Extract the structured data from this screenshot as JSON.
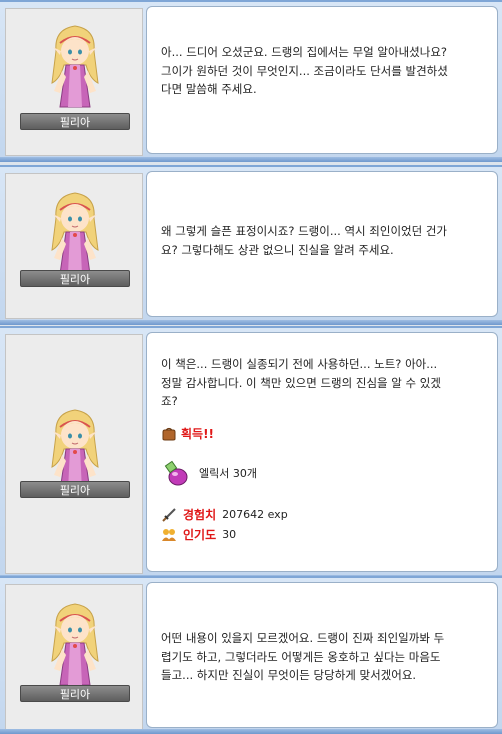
{
  "dialogs": [
    {
      "npc_name": "필리아",
      "lines": "아... 드디어 오셨군요. 드랭의 집에서는 무얼 알아내셨나요?\n그이가 원하던 것이 무엇인지... 조금이라도 단서를 발견하셨\n다면 말씀해 주세요."
    },
    {
      "npc_name": "필리아",
      "lines": "왜 그렇게 슬픈 표정이시죠? 드랭이... 역시 죄인이었던 건가\n요? 그렇다해도 상관 없으니 진실을 알려 주세요."
    },
    {
      "npc_name": "필리아",
      "lines": "이 책은... 드랭이 실종되기 전에 사용하던... 노트? 아아...\n정말 감사합니다. 이 책만 있으면 드랭의 진심을 알 수 있겠\n죠?",
      "rewards": {
        "title": "획득!!",
        "item_name": "엘릭서 30개",
        "exp_label": "경험치",
        "exp_value": "207642 exp",
        "fame_label": "인기도",
        "fame_value": "30"
      }
    },
    {
      "npc_name": "필리아",
      "lines": "어떤 내용이 있을지 모르겠어요. 드랭이 진짜 죄인일까봐 두\n렵기도 하고, 그렇더라도 어떻게든 옹호하고 싶다는 마음도\n들고... 하지만 진실이 무엇이든 당당하게 맞서겠어요."
    }
  ]
}
